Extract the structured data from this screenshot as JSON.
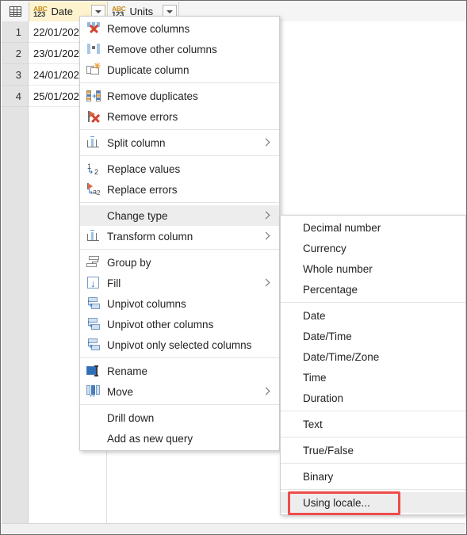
{
  "grid": {
    "corner_icon": "table-icon",
    "columns": [
      {
        "type_abbr_top": "ABC",
        "type_abbr_bottom": "123",
        "name": "Date",
        "filter_icon": "chevron-down-icon",
        "selected": true
      },
      {
        "type_abbr_top": "ABC",
        "type_abbr_bottom": "123",
        "name": "Units",
        "filter_icon": "chevron-down-icon",
        "selected": false
      }
    ],
    "rows": [
      {
        "num": "1",
        "date": "22/01/202"
      },
      {
        "num": "2",
        "date": "23/01/202"
      },
      {
        "num": "3",
        "date": "24/01/202"
      },
      {
        "num": "4",
        "date": "25/01/202"
      }
    ]
  },
  "context_menu": {
    "groups": [
      {
        "items": [
          {
            "label": "Remove columns",
            "icon": "remove-columns-icon",
            "submenu": false
          },
          {
            "label": "Remove other columns",
            "icon": "remove-other-columns-icon",
            "submenu": false
          },
          {
            "label": "Duplicate column",
            "icon": "duplicate-column-icon",
            "submenu": false
          }
        ]
      },
      {
        "items": [
          {
            "label": "Remove duplicates",
            "icon": "remove-duplicates-icon",
            "submenu": false
          },
          {
            "label": "Remove errors",
            "icon": "remove-errors-icon",
            "submenu": false
          }
        ]
      },
      {
        "items": [
          {
            "label": "Split column",
            "icon": "split-column-icon",
            "submenu": true
          }
        ]
      },
      {
        "items": [
          {
            "label": "Replace values",
            "icon": "replace-values-icon",
            "submenu": false
          },
          {
            "label": "Replace errors",
            "icon": "replace-errors-icon",
            "submenu": false
          }
        ]
      },
      {
        "items": [
          {
            "label": "Change type",
            "icon": "",
            "submenu": true,
            "highlighted": true
          },
          {
            "label": "Transform column",
            "icon": "transform-column-icon",
            "submenu": true
          }
        ]
      },
      {
        "items": [
          {
            "label": "Group by",
            "icon": "group-by-icon",
            "submenu": false
          },
          {
            "label": "Fill",
            "icon": "fill-icon",
            "submenu": true
          },
          {
            "label": "Unpivot columns",
            "icon": "unpivot-columns-icon",
            "submenu": false
          },
          {
            "label": "Unpivot other columns",
            "icon": "unpivot-other-columns-icon",
            "submenu": false
          },
          {
            "label": "Unpivot only selected columns",
            "icon": "unpivot-selected-columns-icon",
            "submenu": false
          }
        ]
      },
      {
        "items": [
          {
            "label": "Rename",
            "icon": "rename-icon",
            "submenu": false
          },
          {
            "label": "Move",
            "icon": "move-icon",
            "submenu": true
          }
        ]
      },
      {
        "items": [
          {
            "label": "Drill down",
            "icon": "",
            "submenu": false
          },
          {
            "label": "Add as new query",
            "icon": "",
            "submenu": false
          }
        ]
      }
    ]
  },
  "submenu": {
    "parent": "Change type",
    "groups": [
      {
        "items": [
          {
            "label": "Decimal number"
          },
          {
            "label": "Currency"
          },
          {
            "label": "Whole number"
          },
          {
            "label": "Percentage"
          }
        ]
      },
      {
        "items": [
          {
            "label": "Date"
          },
          {
            "label": "Date/Time"
          },
          {
            "label": "Date/Time/Zone"
          },
          {
            "label": "Time"
          },
          {
            "label": "Duration"
          }
        ]
      },
      {
        "items": [
          {
            "label": "Text"
          }
        ]
      },
      {
        "items": [
          {
            "label": "True/False"
          }
        ]
      },
      {
        "items": [
          {
            "label": "Binary"
          }
        ]
      },
      {
        "items": [
          {
            "label": "Using locale...",
            "highlighted": true,
            "annotated": true
          }
        ]
      }
    ]
  },
  "annotation": {
    "color": "#ef4b4b",
    "target": "Using locale..."
  }
}
